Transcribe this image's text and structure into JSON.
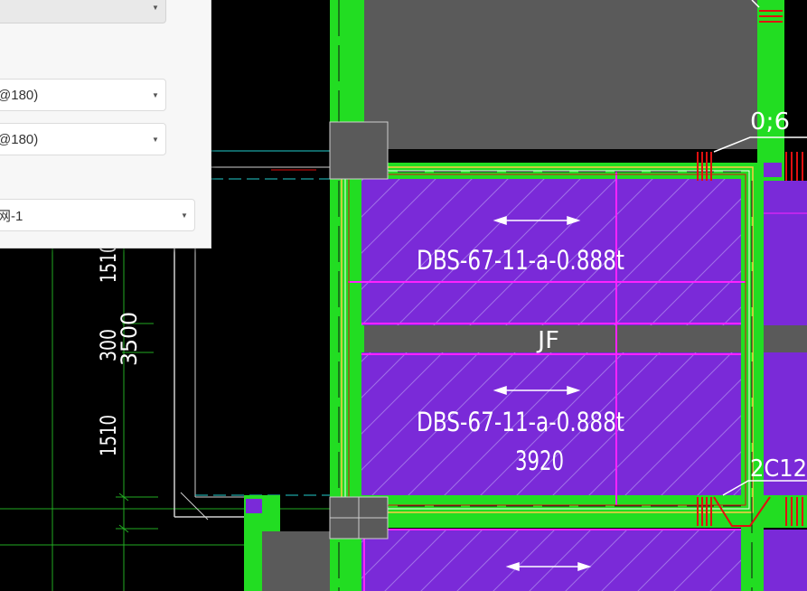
{
  "panel": {
    "fields": [
      {
        "value": ""
      },
      {
        "value": "@180)"
      },
      {
        "value": "@180)"
      },
      {
        "value": "网-1"
      }
    ],
    "dropdown_icon": "chevron-down-icon"
  },
  "drawing": {
    "slab_label_top": "DBS-67-11-a-0.888t",
    "slab_label_bottom": "DBS-67-11-a-0.888t",
    "span_label": "3920",
    "joint_label": "JF",
    "rebar_label_top": "0;6",
    "rebar_label_right": "2C12",
    "dim_1510_top": "1510",
    "dim_300": "300",
    "dim_3500": "3500",
    "dim_1510_bottom": "1510"
  },
  "colors": {
    "background": "#000000",
    "beam_green": "#22dd22",
    "slab_purple": "#7a2ad8",
    "magenta_rebar": "#ff22ff",
    "column_gray": "#5a5a5a",
    "red_rebar": "#e01010",
    "cyan_axis": "#22cccc"
  }
}
